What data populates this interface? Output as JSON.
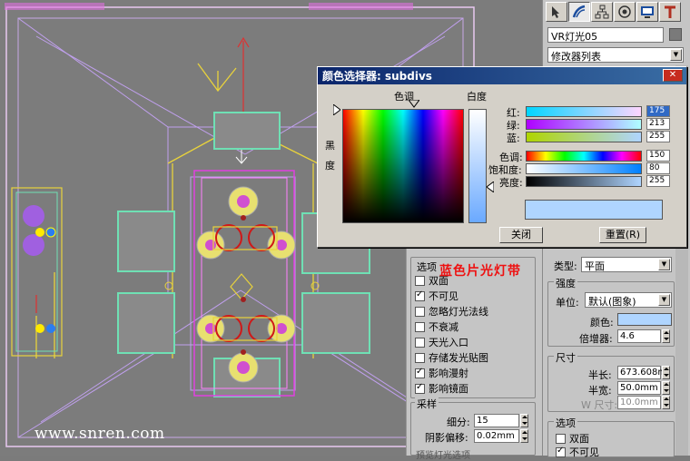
{
  "watermark": "www.snren.com",
  "annotation": "蓝色片光灯带",
  "command_panel": {
    "object_name": "VR灯光05",
    "modifier_list": "修改器列表",
    "type_label": "类型:",
    "type_value": "平面",
    "intensity_title": "强度",
    "unit_label": "单位:",
    "unit_value": "默认(图象)",
    "color_label": "颜色:",
    "color_value": "#afd5ff",
    "multiplier_label": "倍增器:",
    "multiplier_value": "4.6",
    "size_title": "尺寸",
    "half_length_label": "半长:",
    "half_length_value": "673.608m",
    "half_width_label": "半宽:",
    "half_width_value": "50.0mm",
    "w_size_label": "W 尺寸:",
    "w_size_value": "10.0mm",
    "options_title": "选项",
    "opt_double": "双面",
    "opt_invisible": "不可见"
  },
  "options_panel": {
    "title": "选项",
    "items": [
      {
        "label": "双面",
        "checked": false
      },
      {
        "label": "不可见",
        "checked": true
      },
      {
        "label": "忽略灯光法线",
        "checked": false
      },
      {
        "label": "不衰减",
        "checked": false
      },
      {
        "label": "天光入口",
        "checked": false
      },
      {
        "label": "存储发光贴图",
        "checked": false
      },
      {
        "label": "影响漫射",
        "checked": true
      },
      {
        "label": "影响镜面",
        "checked": true
      }
    ],
    "sampling_title": "采样",
    "subdivs_label": "细分:",
    "subdivs_value": "15",
    "shadow_bias_label": "阴影偏移:",
    "shadow_bias_value": "0.02mm",
    "footer": "预览灯光选项"
  },
  "color_dialog": {
    "title": "颜色选择器: subdivs",
    "hue_header": "色调",
    "white_header": "白度",
    "black_label_1": "黑",
    "black_label_2": "度",
    "red_label": "红:",
    "green_label": "绿:",
    "blue_label": "蓝:",
    "hue_label": "色调:",
    "sat_label": "饱和度:",
    "val_label": "亮度:",
    "red": "175",
    "green": "213",
    "blue": "255",
    "hue": "150",
    "sat": "80",
    "val": "255",
    "close_button": "关闭",
    "reset_button": "重置(R)",
    "close_x": "✕"
  }
}
